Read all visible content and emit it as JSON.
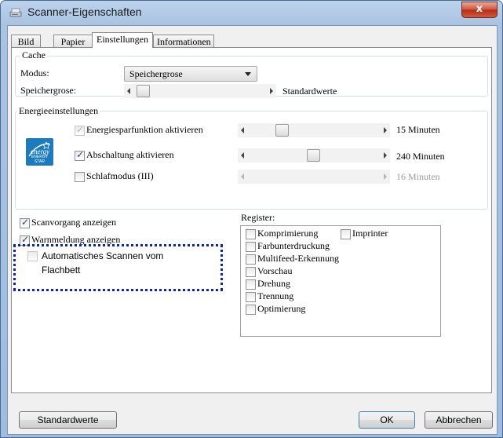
{
  "window": {
    "title": "Scanner-Eigenschaften",
    "close_glyph": "x"
  },
  "tabs": [
    {
      "label": "Bild"
    },
    {
      "label": "Papier"
    },
    {
      "label": "Einstellungen",
      "active": true
    },
    {
      "label": "Informationen"
    }
  ],
  "cache": {
    "group_label": "Cache",
    "mode_label": "Modus:",
    "mode_value": "Speichergrose",
    "size_label": "Speichergrose:",
    "size_value_label": "Standardwerte",
    "size_level_fraction": 0.0
  },
  "energy": {
    "group_label": "Energieeinstellungen",
    "logo": "energy-star-icon",
    "rows": [
      {
        "label": "Energiesparfunktion aktivieren",
        "checked": true,
        "enabled": false,
        "value_label": "15 Minuten",
        "level_fraction": 0.3
      },
      {
        "label": "Abschaltung aktivieren",
        "checked": true,
        "enabled": true,
        "value_label": "240 Minuten",
        "level_fraction": 0.5
      },
      {
        "label": "Schlafmodus (III)",
        "checked": false,
        "enabled": true,
        "value_label": "16 Minuten",
        "value_dimmed": true
      }
    ]
  },
  "options": [
    {
      "label": "Scanvorgang anzeigen",
      "checked": true
    },
    {
      "label": "Warnmeldung anzeigen",
      "checked": true
    }
  ],
  "highlighted_option": {
    "label_line1": "Automatisches Scannen vom",
    "label_line2": "Flachbett",
    "checked": false,
    "enabled": false
  },
  "register": {
    "label": "Register:",
    "items": [
      {
        "label": "Komprimierung",
        "checked": false
      },
      {
        "label": "Farbunterdruckung",
        "checked": false
      },
      {
        "label": "Multifeed-Erkennung",
        "checked": false
      },
      {
        "label": "Vorschau",
        "checked": false
      },
      {
        "label": "Drehung",
        "checked": false
      },
      {
        "label": "Trennung",
        "checked": false
      },
      {
        "label": "Optimierung",
        "checked": false
      }
    ],
    "side_item": {
      "label": "Imprinter",
      "checked": false
    }
  },
  "buttons": {
    "defaults": "Standardwerte",
    "ok": "OK",
    "cancel": "Abbrechen"
  },
  "colors": {
    "highlight_border": "#0a22c9",
    "energy_logo": "#1a7bbf"
  }
}
